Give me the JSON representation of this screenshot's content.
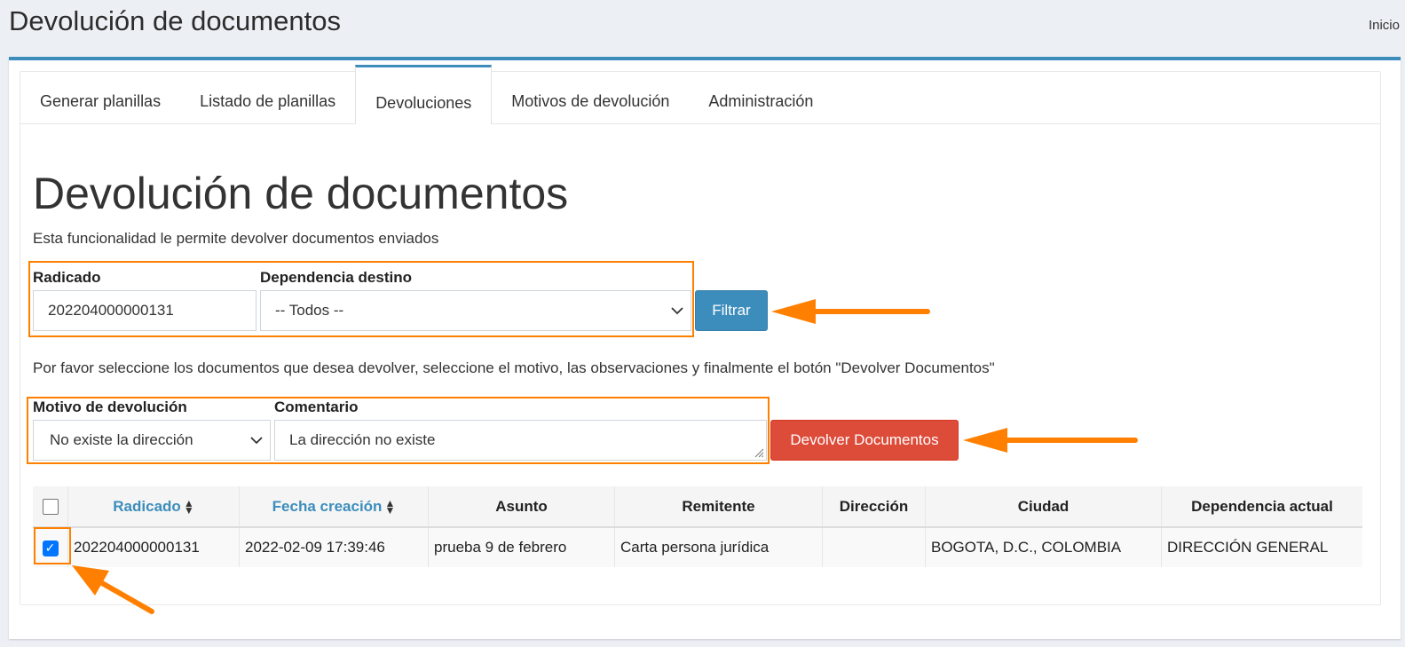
{
  "header": {
    "title": "Devolución de documentos",
    "home_link": "Inicio"
  },
  "tabs": [
    {
      "label": "Generar planillas",
      "active": false
    },
    {
      "label": "Listado de planillas",
      "active": false
    },
    {
      "label": "Devoluciones",
      "active": true
    },
    {
      "label": "Motivos de devolución",
      "active": false
    },
    {
      "label": "Administración",
      "active": false
    }
  ],
  "content": {
    "title": "Devolución de documentos",
    "description": "Esta funcionalidad le permite devolver documentos enviados",
    "instructions": "Por favor seleccione los documentos que desea devolver, seleccione el motivo, las observaciones y finalmente el botón \"Devolver Documentos\""
  },
  "filter": {
    "radicado_label": "Radicado",
    "radicado_value": "202204000000131",
    "dependencia_label": "Dependencia destino",
    "dependencia_value": "-- Todos --",
    "filter_button": "Filtrar"
  },
  "return_form": {
    "motivo_label": "Motivo de devolución",
    "motivo_value": "No existe la dirección",
    "comentario_label": "Comentario",
    "comentario_value": "La dirección no existe",
    "return_button": "Devolver Documentos"
  },
  "table": {
    "columns": [
      "Radicado",
      "Fecha creación",
      "Asunto",
      "Remitente",
      "Dirección",
      "Ciudad",
      "Dependencia actual"
    ],
    "rows": [
      {
        "checked": true,
        "radicado": "202204000000131",
        "fecha": "2022-02-09 17:39:46",
        "asunto": "prueba 9 de febrero",
        "remitente": "Carta persona jurídica",
        "direccion": "",
        "ciudad": "BOGOTA, D.C., COLOMBIA",
        "dependencia": "DIRECCIÓN GENERAL"
      }
    ]
  },
  "colors": {
    "accent": "#3c8dbc",
    "danger": "#dd4b39",
    "annotation": "#ff8000",
    "checkbox": "#0075ff"
  }
}
